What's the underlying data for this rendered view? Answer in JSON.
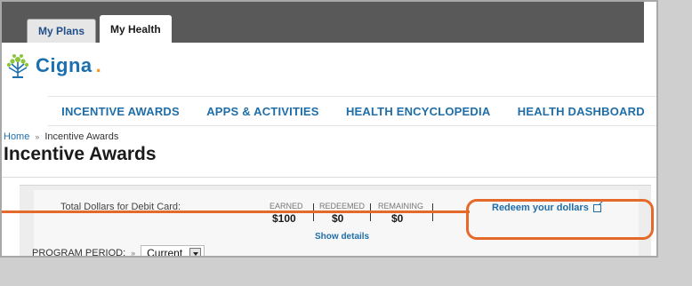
{
  "tabs": [
    {
      "label": "My Plans",
      "active": false
    },
    {
      "label": "My Health",
      "active": true
    }
  ],
  "logo": {
    "text": "Cigna",
    "dot": ".",
    "icon": "cigna-tree-icon"
  },
  "nav": [
    {
      "label": "INCENTIVE AWARDS"
    },
    {
      "label": "APPS & ACTIVITIES"
    },
    {
      "label": "HEALTH ENCYCLOPEDIA"
    },
    {
      "label": "HEALTH DASHBOARD"
    }
  ],
  "breadcrumb": {
    "home": "Home",
    "separator": "»",
    "current": "Incentive Awards"
  },
  "page_title": "Incentive Awards",
  "summary": {
    "total_label": "Total Dollars for Debit Card:",
    "columns": [
      {
        "header": "EARNED",
        "value": "$100"
      },
      {
        "header": "REDEEMED",
        "value": "$0"
      },
      {
        "header": "REMAINING",
        "value": "$0"
      }
    ],
    "show_details": "Show details",
    "redeem_link": "Redeem your dollars"
  },
  "program_period": {
    "label": "PROGRAM PERIOD:",
    "separator": "»",
    "selected": "Current"
  },
  "colors": {
    "accent_blue": "#1f6ea8",
    "highlight_orange": "#e5692a",
    "topbar": "#595959"
  }
}
